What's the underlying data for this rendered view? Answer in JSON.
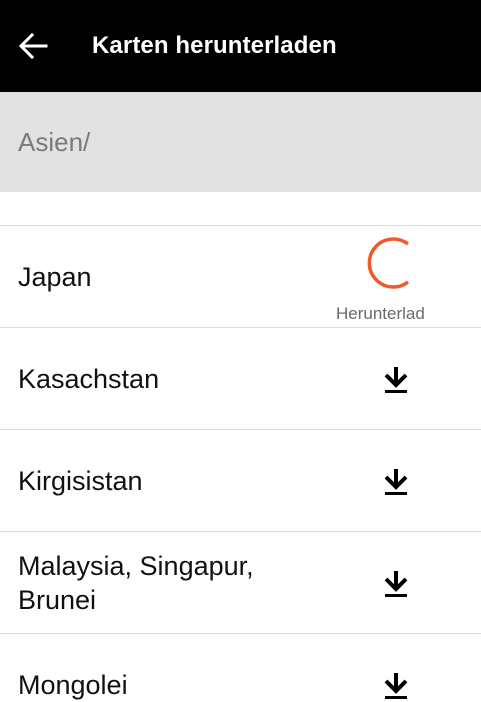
{
  "header": {
    "title": "Karten herunterladen",
    "back_icon": "arrow-left-icon",
    "background": "#000000",
    "text_color": "#ffffff"
  },
  "breadcrumb": {
    "path": "Asien/",
    "background": "#e2e2e2"
  },
  "list": {
    "items": [
      {
        "label": "Japan",
        "status": "downloading",
        "status_label": "Herunterlad",
        "icon": "loading-spinner-icon",
        "accent": "#f05a28"
      },
      {
        "label": "Kasachstan",
        "status": "available",
        "icon": "download-icon"
      },
      {
        "label": "Kirgisistan",
        "status": "available",
        "icon": "download-icon"
      },
      {
        "label": "Malaysia, Singapur, Brunei",
        "status": "available",
        "icon": "download-icon"
      },
      {
        "label": "Mongolei",
        "status": "available",
        "icon": "download-icon"
      }
    ]
  }
}
